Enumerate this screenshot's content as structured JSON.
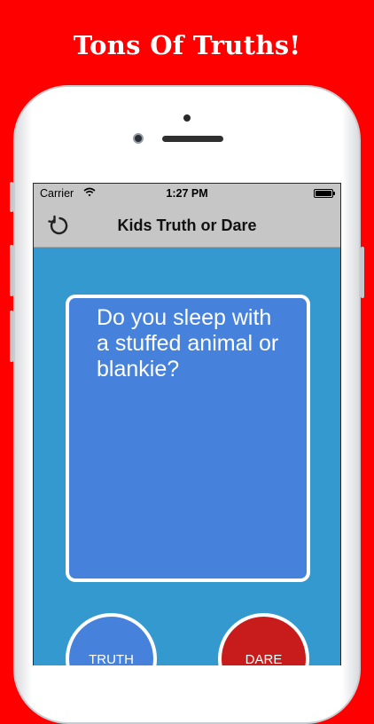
{
  "promo": {
    "headline": "Tons Of Truths!"
  },
  "status_bar": {
    "carrier": "Carrier",
    "time": "1:27 PM"
  },
  "nav": {
    "title": "Kids Truth or Dare",
    "refresh_icon": "refresh-icon"
  },
  "card": {
    "question": "Do you sleep with a stuffed animal or blankie?"
  },
  "buttons": {
    "truth_label": "TRUTH",
    "dare_label": "DARE"
  },
  "colors": {
    "background": "#fe0000",
    "screen": "#3499cf",
    "card": "#4682dc",
    "truth": "#4682dc",
    "dare": "#c81c1c",
    "nav_bar": "#c6c6c6"
  }
}
